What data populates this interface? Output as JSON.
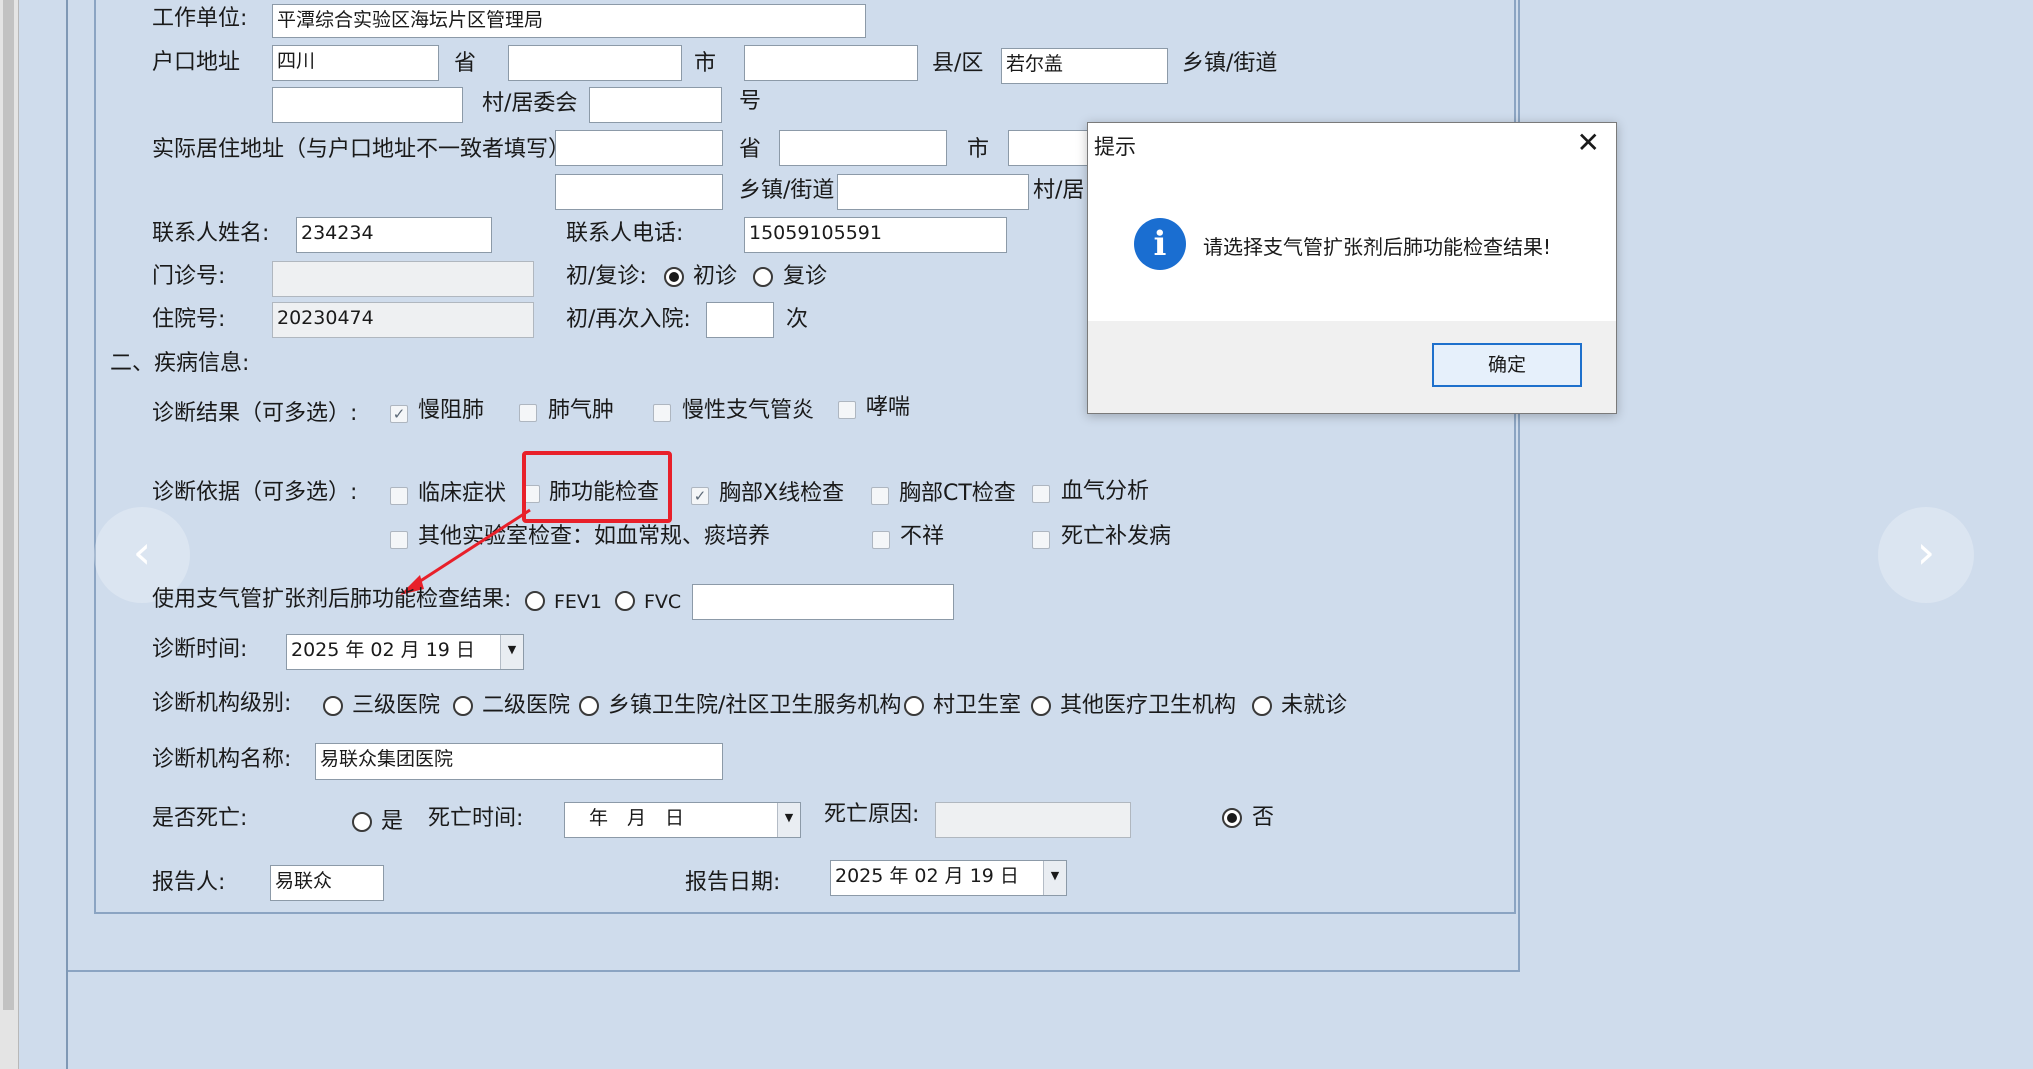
{
  "form": {
    "work_unit_label": "工作单位:",
    "work_unit_value": "平潭综合实验区海坛片区管理局",
    "hukou_label": "户口地址",
    "hukou_province_value": "四川",
    "province_unit": "省",
    "city_unit": "市",
    "county_unit": "县/区",
    "hukou_county_value": "若尔盖",
    "town_unit": "乡镇/街道",
    "village_unit": "村/居委会",
    "number_unit": "号",
    "residence_label": "实际居住地址（与户口地址不一致者填写）",
    "res_province_unit": "省",
    "res_city_unit": "市",
    "res_town_unit": "乡镇/街道",
    "res_village_unit": "村/居",
    "contact_name_label": "联系人姓名:",
    "contact_name_value": "234234",
    "contact_phone_label": "联系人电话:",
    "contact_phone_value": "15059105591",
    "outpatient_label": "门诊号:",
    "visit_type_label": "初/复诊:",
    "visit_first": "初诊",
    "visit_return": "复诊",
    "inpatient_label": "住院号:",
    "inpatient_value": "20230474",
    "admission_label": "初/再次入院:",
    "admission_unit": "次",
    "section2_title": "二、疾病信息:",
    "diag_result_label": "诊断结果（可多选）:",
    "diag_results": [
      "慢阻肺",
      "肺气肿",
      "慢性支气管炎",
      "哮喘"
    ],
    "diag_basis_label": "诊断依据（可多选）:",
    "diag_basis": [
      "临床症状",
      "肺功能检查",
      "胸部X线检查",
      "胸部CT检查",
      "血气分析"
    ],
    "diag_basis_row2": [
      "其他实验室检查：如血常规、痰培养",
      "不祥",
      "死亡补发病"
    ],
    "bronchodilator_label": "使用支气管扩张剂后肺功能检查结果:",
    "fev1": "FEV1",
    "fvc": "FVC",
    "diag_time_label": "诊断时间:",
    "diag_time_value": "2025 年 02 月 19 日",
    "inst_level_label": "诊断机构级别:",
    "inst_levels": [
      "三级医院",
      "二级医院",
      "乡镇卫生院/社区卫生服务机构",
      "村卫生室",
      "其他医疗卫生机构",
      "未就诊"
    ],
    "inst_name_label": "诊断机构名称:",
    "inst_name_value": "易联众集团医院",
    "death_label": "是否死亡:",
    "death_yes": "是",
    "death_time_label": "死亡时间:",
    "death_time_value": "年　月　日",
    "death_cause_label": "死亡原因:",
    "death_no": "否",
    "reporter_label": "报告人:",
    "reporter_value": "易联众",
    "report_date_label": "报告日期:",
    "report_date_value": "2025 年 02 月 19 日"
  },
  "dialog": {
    "title": "提示",
    "message": "请选择支气管扩张剂后肺功能检查结果!",
    "ok_label": "确定"
  },
  "colors": {
    "highlight_box": "#e8202a",
    "dialog_icon": "#1a6ed1",
    "background": "#cfdcec"
  }
}
